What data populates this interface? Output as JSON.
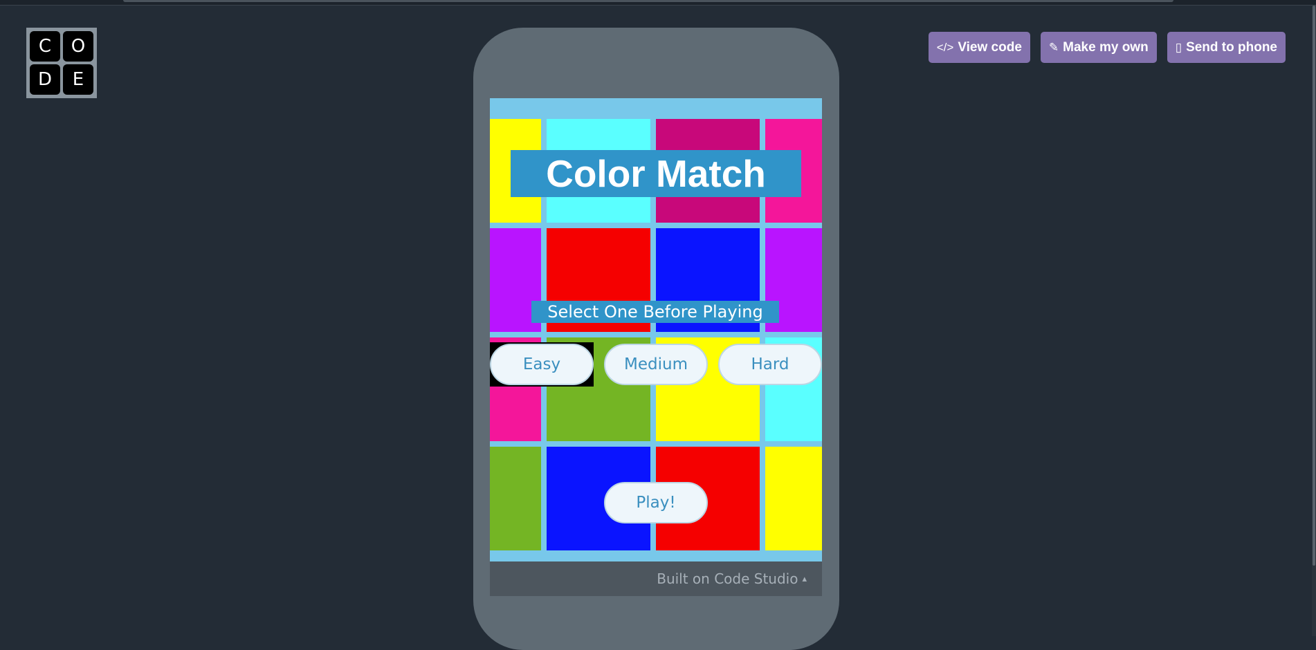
{
  "logo": {
    "letters": [
      "C",
      "O",
      "D",
      "E"
    ]
  },
  "actions": [
    {
      "icon": "</>",
      "label": "View code"
    },
    {
      "icon": "✎",
      "label": "Make my own"
    },
    {
      "icon": "▯",
      "label": "Send to phone"
    }
  ],
  "app": {
    "title": "Color Match",
    "subtitle": "Select One Before Playing",
    "difficulty": [
      "Easy",
      "Medium",
      "Hard"
    ],
    "selected_difficulty": "Easy",
    "play_label": "Play!",
    "grid_colors": [
      [
        "#ffff00",
        "#5affff",
        "#c8087a",
        "#f4169a"
      ],
      [
        "#b914ff",
        "#f50000",
        "#0a14ff",
        "#b914ff"
      ],
      [
        "#f4169a",
        "#74b524",
        "#ffff00",
        "#5affff"
      ],
      [
        "#74b524",
        "#0a14ff",
        "#f50000",
        "#ffff00"
      ]
    ],
    "background_color": "#78c8ea"
  },
  "footer": {
    "text": "Built on Code Studio",
    "caret": "▴"
  },
  "colors": {
    "page": "#232c36",
    "accent": "#8372ad",
    "title_box": "#3094c9"
  }
}
